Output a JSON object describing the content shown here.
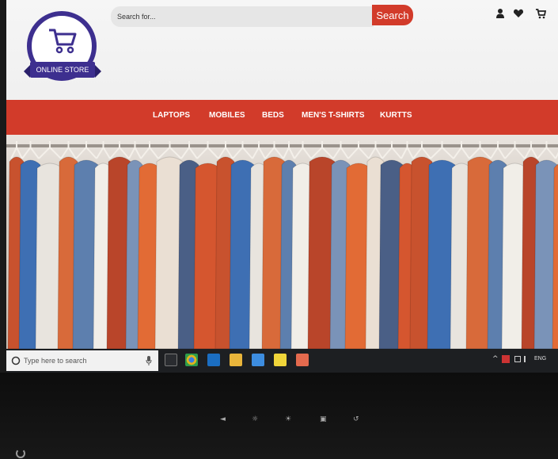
{
  "logo": {
    "text": "ONLINE STORE",
    "icon": "shopping-cart-icon",
    "color": "#3d2f8f"
  },
  "search": {
    "placeholder": "Search for...",
    "button_label": "Search",
    "button_color": "#d23b2a"
  },
  "header_icons": [
    "user-icon",
    "heart-icon",
    "cart-icon"
  ],
  "nav": {
    "color": "#d23b2a",
    "items": [
      {
        "label": "LAPTOPS"
      },
      {
        "label": "MOBILES"
      },
      {
        "label": "BEDS"
      },
      {
        "label": "MEN'S T-SHIRTS"
      },
      {
        "label": "KURTTS"
      }
    ]
  },
  "hero": {
    "description_icon": "clothing-rack-image"
  },
  "taskbar": {
    "search_placeholder": "Type here to search",
    "apps": [
      "task-view-icon",
      "chrome-icon",
      "edge-icon",
      "file-explorer-icon",
      "photos-icon",
      "sticky-notes-icon",
      "app-icon"
    ],
    "tray": {
      "language": "ENG"
    }
  },
  "bezel": {
    "buttons": [
      "menu-icon",
      "brightness-down-icon",
      "brightness-up-icon",
      "input-source-icon",
      "back-icon"
    ]
  }
}
